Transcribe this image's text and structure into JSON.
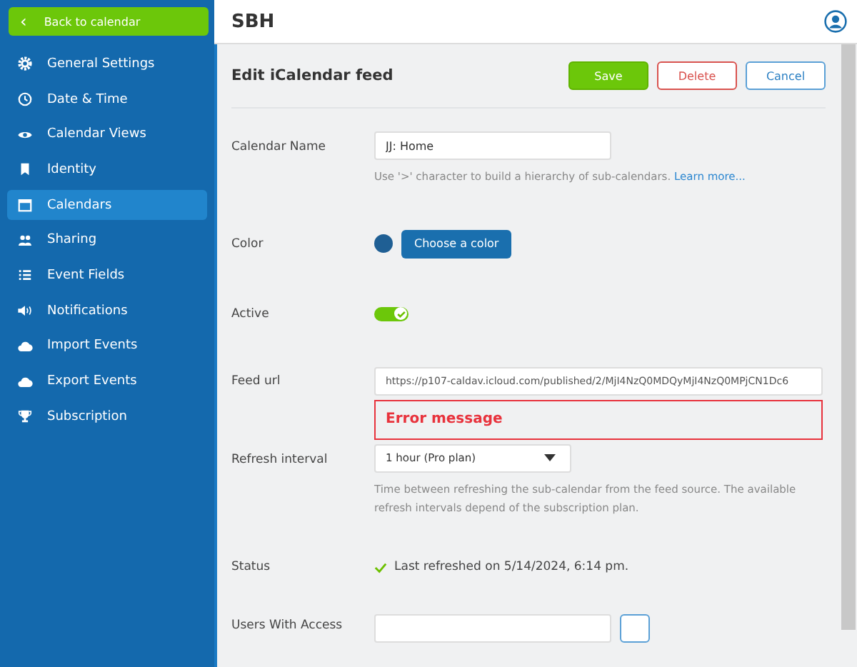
{
  "back_button": {
    "label": "Back to calendar",
    "icon": "‹"
  },
  "header": {
    "title": "SBH"
  },
  "sidebar": {
    "items": [
      {
        "label": "General Settings",
        "selected": false
      },
      {
        "label": "Date & Time",
        "selected": false
      },
      {
        "label": "Calendar Views",
        "selected": false
      },
      {
        "label": "Identity",
        "selected": false
      },
      {
        "label": "Calendars",
        "selected": true
      },
      {
        "label": "Sharing",
        "selected": false
      },
      {
        "label": "Event Fields",
        "selected": false
      },
      {
        "label": "Notifications",
        "selected": false
      },
      {
        "label": "Import Events",
        "selected": false
      },
      {
        "label": "Export Events",
        "selected": false
      },
      {
        "label": "Subscription",
        "selected": false
      }
    ]
  },
  "form": {
    "title": "Edit iCalendar feed",
    "buttons": [
      {
        "label": "Save",
        "kind": "primary"
      },
      {
        "label": "Delete",
        "kind": "danger"
      },
      {
        "label": "Cancel",
        "kind": "secondary"
      }
    ],
    "calendar_name": {
      "label": "Calendar Name",
      "value": "JJ: Home",
      "hint": "Use '>' character to build a hierarchy of sub-calendars.",
      "link": "Learn more..."
    },
    "color": {
      "label": "Color",
      "color": "#1f5f94",
      "button": "Choose a color"
    },
    "active": {
      "label": "Active",
      "on": true
    },
    "feed_url": {
      "label": "Feed url",
      "value": "https://p107-caldav.icloud.com/published/2/MjI4NzQ0MDQyMjI4NzQ0MPjCN1Dc6",
      "error": "Error message"
    },
    "refresh_interval": {
      "label": "Refresh interval",
      "value": "1 hour (Pro plan)",
      "hint": "Time between refreshing the sub-calendar from the feed source. The available refresh intervals depend of the subscription plan."
    },
    "status": {
      "label": "Status",
      "ok": true,
      "text": "Last refreshed on 5/14/2024, 6:14 pm."
    },
    "users_with_access": {
      "label": "Users With Access"
    }
  }
}
